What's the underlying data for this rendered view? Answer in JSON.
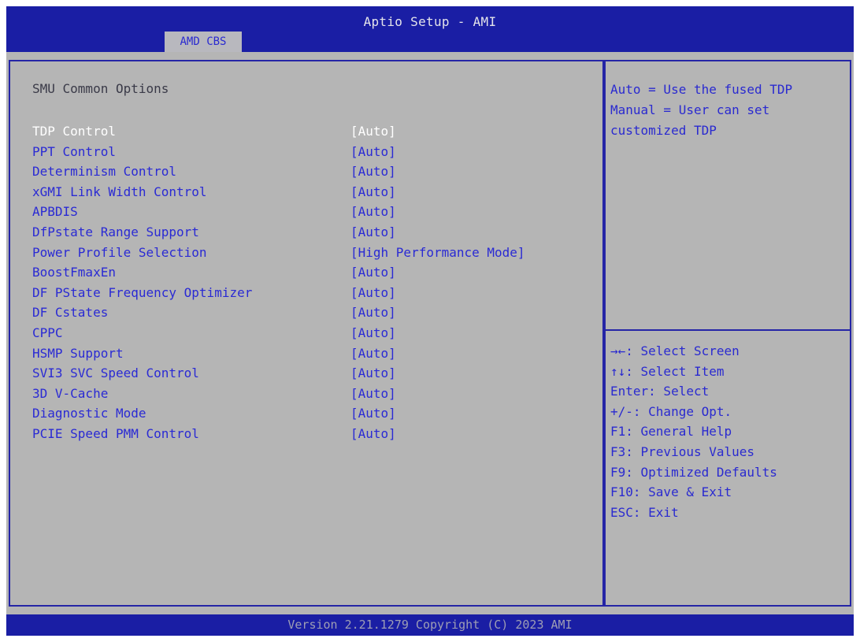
{
  "header": {
    "title": "Aptio Setup - AMI",
    "active_tab": "AMD CBS"
  },
  "main": {
    "section_title": "SMU Common Options",
    "selected_index": 0,
    "options": [
      {
        "label": "TDP Control",
        "value": "[Auto]"
      },
      {
        "label": "PPT Control",
        "value": "[Auto]"
      },
      {
        "label": "Determinism Control",
        "value": "[Auto]"
      },
      {
        "label": "xGMI Link Width Control",
        "value": "[Auto]"
      },
      {
        "label": "APBDIS",
        "value": "[Auto]"
      },
      {
        "label": "DfPstate Range Support",
        "value": "[Auto]"
      },
      {
        "label": "Power Profile Selection",
        "value": "[High Performance Mode]"
      },
      {
        "label": "BoostFmaxEn",
        "value": "[Auto]"
      },
      {
        "label": "DF PState Frequency Optimizer",
        "value": "[Auto]"
      },
      {
        "label": "DF Cstates",
        "value": "[Auto]"
      },
      {
        "label": "CPPC",
        "value": "[Auto]"
      },
      {
        "label": "HSMP Support",
        "value": "[Auto]"
      },
      {
        "label": "SVI3 SVC Speed Control",
        "value": "[Auto]"
      },
      {
        "label": "3D V-Cache",
        "value": "[Auto]"
      },
      {
        "label": "Diagnostic Mode",
        "value": "[Auto]"
      },
      {
        "label": "PCIE Speed PMM Control",
        "value": "[Auto]"
      }
    ]
  },
  "help": {
    "lines": [
      "Auto = Use the fused TDP",
      "Manual = User can set",
      "customized TDP"
    ]
  },
  "keys": [
    "→←: Select Screen",
    "↑↓: Select Item",
    "Enter: Select",
    "+/-: Change Opt.",
    "F1: General Help",
    "F3: Previous Values",
    "F9: Optimized Defaults",
    "F10: Save & Exit",
    "ESC: Exit"
  ],
  "footer": {
    "text": "Version 2.21.1279 Copyright (C) 2023 AMI"
  },
  "colors": {
    "header_bg": "#1a1ea4",
    "panel_bg": "#b5b5b5",
    "option_text": "#2a2ad4",
    "selected_text": "#ffffff",
    "label_text": "#3a3a48"
  }
}
